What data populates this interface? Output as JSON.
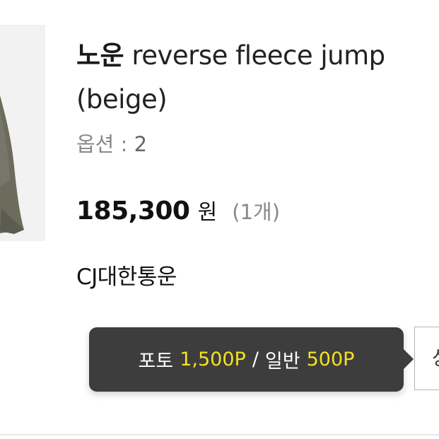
{
  "product": {
    "brand": "노운",
    "name": "reverse fleece jump",
    "color": "(beige)",
    "option_label": "옵션 : ",
    "option_value": "2",
    "price": "185,300",
    "currency": "원",
    "quantity": "(1개)",
    "shipping_carrier": "CJ대한통운",
    "image_icon": "beige-garment-thumbnail"
  },
  "review_points": {
    "photo_label": "포토",
    "photo_points": "1,500P",
    "separator": "/",
    "general_label": "일반",
    "general_points": "500P",
    "highlight_color": "#f4e21f",
    "background_color": "#3d3d3d"
  },
  "side_button": {
    "label": "상"
  }
}
